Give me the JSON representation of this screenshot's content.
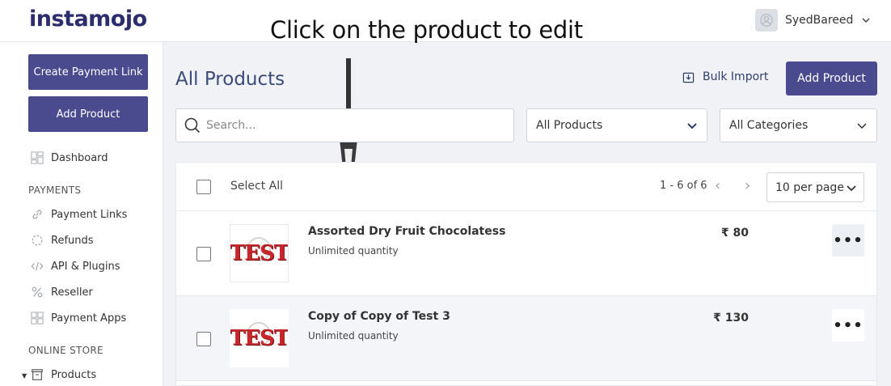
{
  "brand": {
    "name": "instamojo"
  },
  "user": {
    "name": "SyedBareed"
  },
  "annotation": {
    "text": "Click on the product to edit"
  },
  "sidebar": {
    "create_link": "Create Payment Link",
    "add_product": "Add Product",
    "dashboard": "Dashboard",
    "payments_section": "PAYMENTS",
    "payment_items": [
      "Payment Links",
      "Refunds",
      "API & Plugins",
      "Reseller",
      "Payment Apps"
    ],
    "store_section": "ONLINE STORE",
    "products": "Products"
  },
  "main": {
    "title": "All Products",
    "bulk_import": "Bulk Import",
    "add_product": "Add Product",
    "search_placeholder": "Search...",
    "filter_products": "All Products",
    "filter_categories": "All Categories",
    "select_all": "Select All",
    "pagination": "1 - 6 of 6",
    "per_page": "10 per page"
  },
  "products": [
    {
      "name": "Assorted Dry Fruit Chocolatess",
      "quantity": "Unlimited quantity",
      "price": "₹ 80",
      "thumb": "TEST"
    },
    {
      "name": "Copy of Copy of Test 3",
      "quantity": "Unlimited quantity",
      "price": "₹ 130",
      "thumb": "TEST"
    }
  ],
  "colors": {
    "brand": "#4a4b8f",
    "title": "#3b4a7a",
    "navy": "#2c2d6e"
  }
}
